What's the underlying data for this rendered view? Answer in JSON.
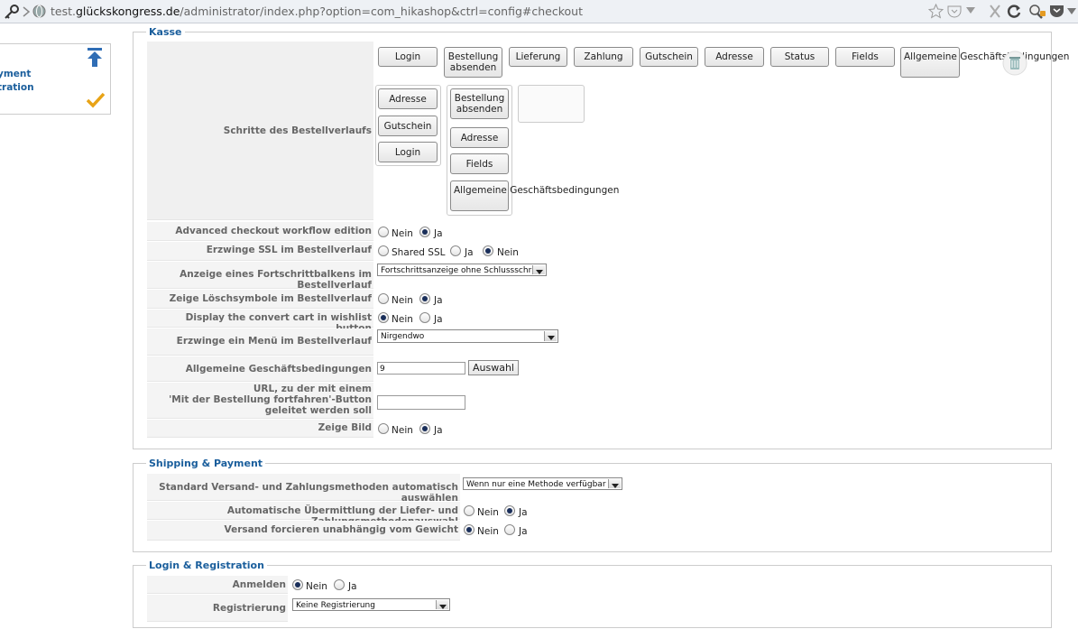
{
  "browser": {
    "url_prefix": "test.",
    "url_host": "glückskongress.de",
    "url_path": "/administrator/index.php?option=com_hikashop&ctrl=config#checkout"
  },
  "sidebar": {
    "link1": "yment",
    "link2": "tration"
  },
  "kasse": {
    "legend": "Kasse",
    "steps_label": "Schritte des Bestellverlaufs",
    "toolbar_buttons": [
      "Login",
      "Bestellung absenden",
      "Lieferung",
      "Zahlung",
      "Gutschein",
      "Adresse",
      "Status",
      "Fields",
      "Allgemeine Geschäftsbedingungen"
    ],
    "group1": [
      "Adresse",
      "Gutschein",
      "Login"
    ],
    "group2": [
      "Bestellung absenden",
      "Adresse",
      "Fields",
      "Allgemeine Geschäftsbedingungen"
    ],
    "advanced_label": "Advanced checkout workflow edition",
    "ssl_label": "Erzwinge SSL im Bestellverlauf",
    "progress_label": "Anzeige eines Fortschrittbalkens im Bestellverlauf",
    "progress_value": "Fortschrittsanzeige ohne Schlussschritt",
    "delete_label": "Zeige Löschsymbole im Bestellverlauf",
    "convert_label": "Display the convert cart in wishlist button",
    "menu_label": "Erzwinge ein Menü im Bestellverlauf",
    "menu_value": "Nirgendwo",
    "terms_label": "Allgemeine Geschäftsbedingungen",
    "terms_value": "9",
    "terms_button": "Auswahl",
    "url_label_1": "URL, zu der mit einem",
    "url_label_2": "'Mit der Bestellung fortfahren'-Button",
    "url_label_3": "geleitet werden soll",
    "image_label": "Zeige Bild"
  },
  "options": {
    "nein": "Nein",
    "ja": "Ja",
    "shared_ssl": "Shared SSL"
  },
  "shipping": {
    "legend": "Shipping & Payment",
    "auto_select_label": "Standard Versand- und Zahlungsmethoden automatisch auswählen",
    "auto_select_value": "Wenn nur eine Methode verfügbar ist",
    "auto_submit_label": "Automatische Übermittlung der Liefer- und Zahlungsmethodenauswahl",
    "force_label": "Versand forcieren unabhängig vom Gewicht"
  },
  "login": {
    "legend": "Login & Registration",
    "login_label": "Anmelden",
    "registration_label": "Registrierung",
    "registration_value": "Keine Registrierung"
  }
}
